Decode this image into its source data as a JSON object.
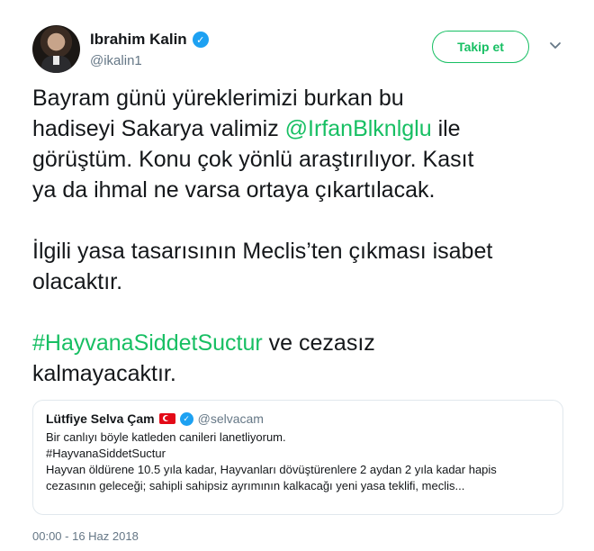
{
  "author": {
    "name": "Ibrahim Kalin",
    "handle": "@ikalin1"
  },
  "actions": {
    "follow_label": "Takip et",
    "more_icon": "chevron-down-icon"
  },
  "tweet": {
    "p1_a": "Bayram günü yüreklerimizi burkan bu",
    "p1_b": "hadiseyi Sakarya valimiz ",
    "p1_mention": "@IrfanBlknlglu",
    "p1_c": " ile",
    "p1_d": "görüştüm. Konu çok yönlü araştırılıyor. Kasıt",
    "p1_e": "ya da ihmal ne varsa ortaya çıkartılacak.",
    "p2_a": "İlgili yasa tasarısının Meclis’ten çıkması isabet",
    "p2_b": "olacaktır.",
    "p3_hashtag": "#HayvanaSiddetSuctur",
    "p3_a": " ve cezasız",
    "p3_b": "kalmayacaktır."
  },
  "quoted": {
    "name": "Lütfiye Selva Çam",
    "handle": "@selvacam",
    "line1": "Bir canlıyı böyle katleden canileri lanetliyorum.",
    "line2": "#HayvanaSiddetSuctur",
    "line3": "Hayvan öldürene 10.5 yıla kadar, Hayvanları dövüştürenlere 2 aydan 2 yıla kadar hapis",
    "line4": "cezasının geleceği; sahipli sahipsiz ayrımının kalkacağı  yeni yasa teklifi, meclis..."
  },
  "meta": {
    "timestamp": "00:00 - 16 Haz 2018"
  },
  "colors": {
    "accent": "#17bf63",
    "verified": "#1da1f2",
    "secondary_text": "#657786"
  }
}
